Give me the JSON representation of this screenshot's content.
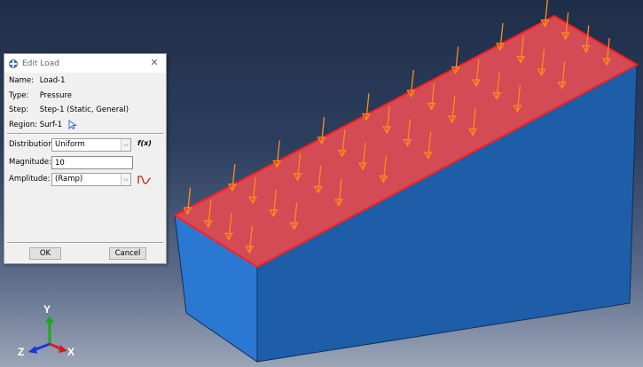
{
  "dialog": {
    "title": "Edit Load",
    "close_glyph": "✕",
    "name_label": "Name:",
    "name_value": "Load-1",
    "type_label": "Type:",
    "type_value": "Pressure",
    "step_label": "Step:",
    "step_value": "Step-1 (Static, General)",
    "region_label": "Region:",
    "region_value": "Surf-1",
    "distribution_label": "Distribution:",
    "distribution_value": "Uniform",
    "fx_label": "f(x)",
    "magnitude_label": "Magnitude:",
    "magnitude_value": "10",
    "amplitude_label": "Amplitude:",
    "amplitude_value": "(Ramp)",
    "ok_label": "OK",
    "cancel_label": "Cancel"
  },
  "triad": {
    "y_label": "Y",
    "z_label": "Z",
    "x_label": "X"
  },
  "colors": {
    "box_front": "#2a74cc",
    "box_right": "#1e5ea8",
    "box_top": "#d24a54",
    "surface_outline": "#ff1f1f",
    "arrow": "#ff8c1a",
    "axis_x": "#d81c1c",
    "axis_y": "#1ea81e",
    "axis_z": "#1c36d8"
  },
  "icons": [
    "abaqus-app-icon",
    "close-icon",
    "region-pick-arrow-icon",
    "chevron-down-icon",
    "amplitude-curve-icon"
  ]
}
